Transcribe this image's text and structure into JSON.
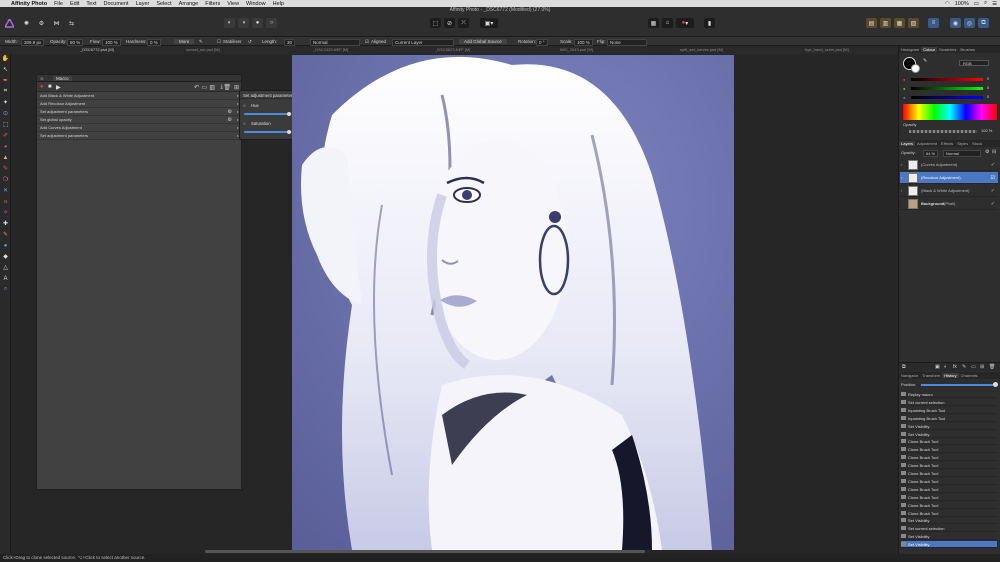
{
  "menubar": {
    "apple": "",
    "items": [
      "Affinity Photo",
      "File",
      "Edit",
      "Text",
      "Document",
      "Layer",
      "Select",
      "Arrange",
      "Filters",
      "View",
      "Window",
      "Help"
    ],
    "battery": "100%",
    "wifi": "wifi"
  },
  "window": {
    "title": "Affinity Photo - _DSC6772 (Modified) (27.0%)"
  },
  "context": {
    "width_label": "Width:",
    "width_value": "309.9 px",
    "opacity_label": "Opacity:",
    "opacity_value": "50 %",
    "flow_label": "Flow:",
    "flow_value": "100 %",
    "hardness_label": "Hardness:",
    "hardness_value": "0 %",
    "more": "More",
    "stabiliser": "Stabiliser",
    "length_label": "Length:",
    "length_value": "30",
    "blend_mode": "Normal",
    "aligned": "Aligned",
    "source": "Current Layer",
    "add_global_source": "Add Global Source",
    "rotation_label": "Rotation:",
    "rotation_value": "0 °",
    "scale_label": "Scale:",
    "scale_value": "100 %",
    "flip_label": "Flip:",
    "flip_value": "None"
  },
  "tabs": [
    "_DSC6772.psd [M]",
    "sunset_sm.psd [M]",
    "_DSC2325.NEF [M]",
    "_DSC5623.NEF [M]",
    "IMG_2543.psd [M]",
    "split_set_curves.psd [M]",
    "bye_hand_scrim.psd [M]"
  ],
  "macro": {
    "title": "Macro",
    "rows": [
      {
        "label": "Add Black & White Adjustment",
        "gear": false
      },
      {
        "label": "Add Recolour Adjustment",
        "gear": false
      },
      {
        "label": "Set adjustment parameters",
        "gear": true
      },
      {
        "label": "Set global opacity",
        "gear": true
      },
      {
        "label": "Add Curves Adjustment",
        "gear": false
      },
      {
        "label": "Set adjustment parameters",
        "gear": false
      }
    ]
  },
  "popover": {
    "title": "Set adjustment parameters",
    "hue_label": "Hue",
    "hue_value": "229.8 °",
    "hue_level": 0.64,
    "sat_label": "Saturation",
    "sat_value": "64 %",
    "sat_level": 0.64
  },
  "colour_panel": {
    "tabs": [
      "Histogram",
      "Colour",
      "Swatches",
      "Brushes"
    ],
    "active": "Colour",
    "model": "RGB",
    "r": "0",
    "g": "0",
    "b": "0",
    "opacity_label": "Opacity",
    "opacity_value": "100 %"
  },
  "layers_panel": {
    "tabs": [
      "Layers",
      "Adjustment",
      "Effects",
      "Styles",
      "Stock"
    ],
    "opacity_label": "Opacity:",
    "opacity_value": "64 %",
    "blend": "Normal",
    "layers": [
      {
        "name": "(Curves Adjustment)",
        "selected": false
      },
      {
        "name": "(Recolour Adjustment)",
        "selected": true
      },
      {
        "name": "(Black & White Adjustment)",
        "selected": false
      },
      {
        "name": "Background",
        "extra": "(Pixel)",
        "selected": false
      }
    ]
  },
  "history_panel": {
    "tabs": [
      "Navigator",
      "Transform",
      "History",
      "Channels"
    ],
    "position_label": "Position:",
    "items": [
      "Replay macro",
      "Set current selection",
      "Inpainting Brush Tool",
      "Inpainting Brush Tool",
      "Set Visibility",
      "Set Visibility",
      "Clone Brush Tool",
      "Clone Brush Tool",
      "Clone Brush Tool",
      "Clone Brush Tool",
      "Clone Brush Tool",
      "Clone Brush Tool",
      "Clone Brush Tool",
      "Clone Brush Tool",
      "Clone Brush Tool",
      "Clone Brush Tool",
      "Set Visibility",
      "Set current selection",
      "Set Visibility",
      "Set Visibility"
    ]
  },
  "status": {
    "text": "Click+Drag to clone selected source. ⌥+Click to select another source."
  }
}
